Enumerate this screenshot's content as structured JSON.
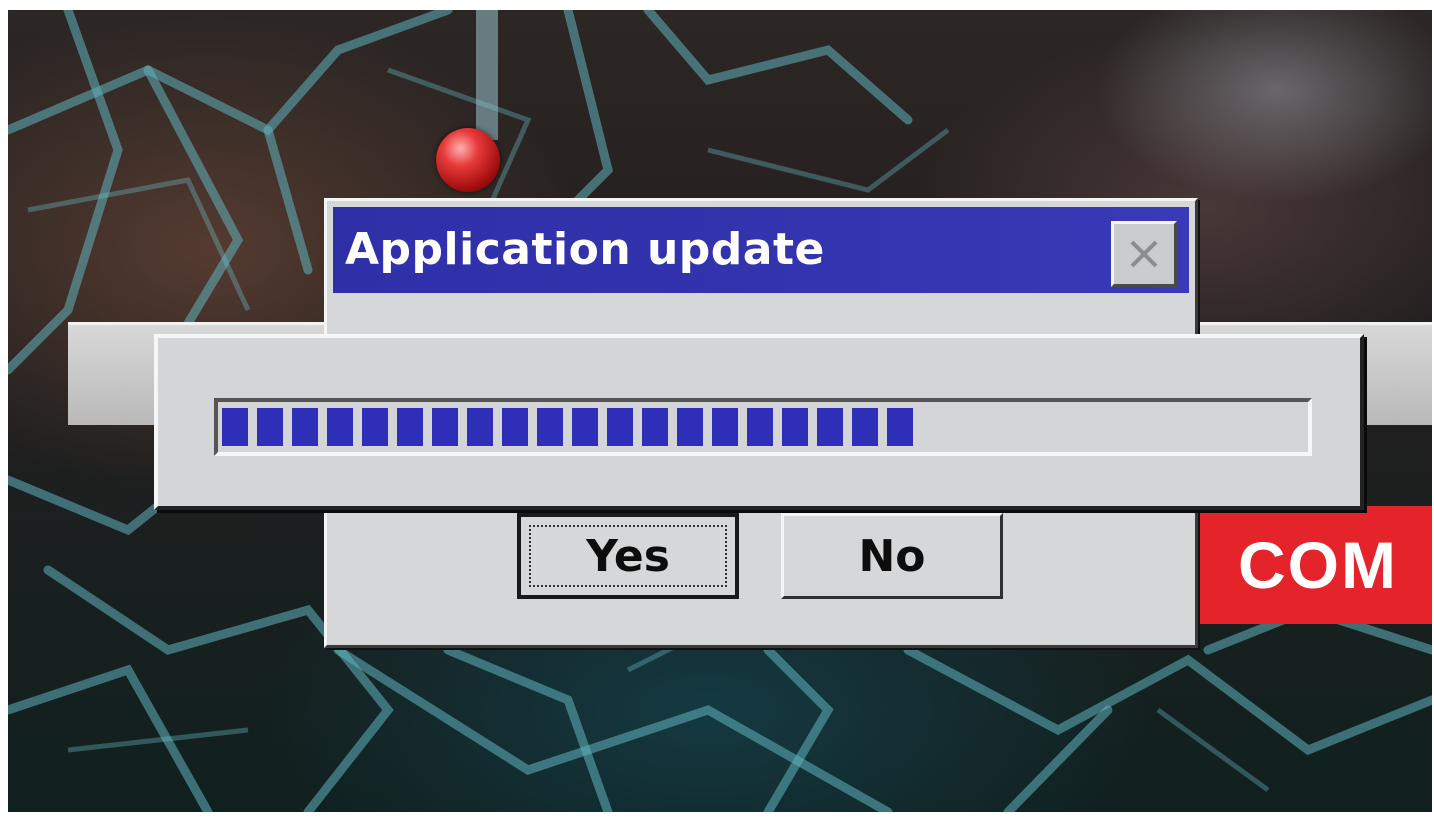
{
  "dialog": {
    "title": "Application update",
    "close_icon": "close-icon",
    "buttons": {
      "yes_label": "Yes",
      "no_label": "No"
    }
  },
  "progress": {
    "fraction": 0.64
  },
  "background": {
    "banner_text": "COM",
    "pin_icon": "map-pin-icon"
  },
  "colors": {
    "title_bar": "#3434b0",
    "progress_block": "#2e2eb8",
    "banner": "#e4232a",
    "dialog_face": "#d5d7d9"
  }
}
